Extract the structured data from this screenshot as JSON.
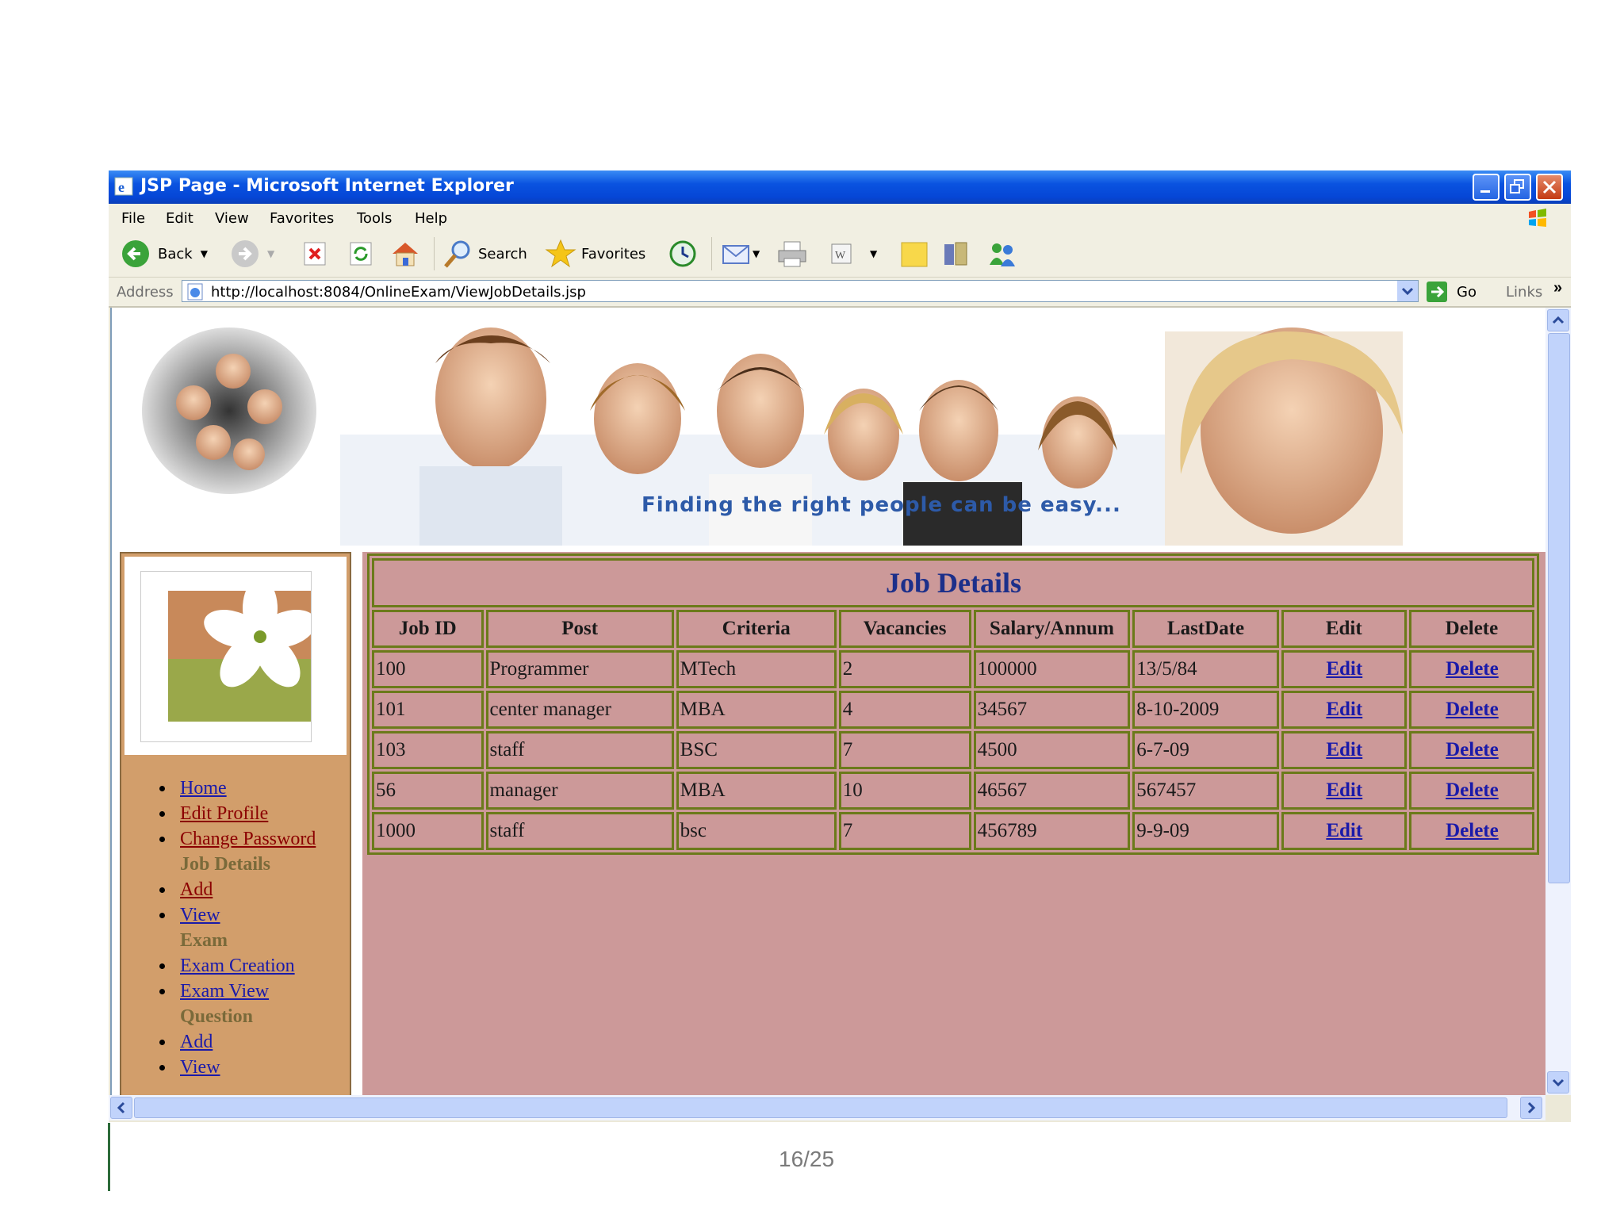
{
  "window": {
    "title": "JSP Page - Microsoft Internet Explorer"
  },
  "menu": [
    "File",
    "Edit",
    "View",
    "Favorites",
    "Tools",
    "Help"
  ],
  "toolbar": {
    "back_label": "Back",
    "search_label": "Search",
    "favorites_label": "Favorites"
  },
  "address": {
    "label": "Address",
    "url": "http://localhost:8084/OnlineExam/ViewJobDetails.jsp",
    "go_label": "Go",
    "links_label": "Links"
  },
  "banner": {
    "caption": "Finding the right people can be easy..."
  },
  "nav": {
    "home": "Home",
    "edit_profile": "Edit Profile",
    "change_password": "Change Password",
    "job_heading": "Job Details",
    "job_add": "Add",
    "job_view": "View",
    "exam_heading": "Exam",
    "exam_creation": "Exam Creation",
    "exam_view": "Exam View",
    "question_heading": "Question",
    "question_add": "Add",
    "question_view": "View"
  },
  "jobs": {
    "title": "Job Details",
    "headers": [
      "Job ID",
      "Post",
      "Criteria",
      "Vacancies",
      "Salary/Annum",
      "LastDate",
      "Edit",
      "Delete"
    ],
    "rows": [
      [
        "100",
        "Programmer",
        "MTech",
        "2",
        "100000",
        "13/5/84",
        "Edit",
        "Delete"
      ],
      [
        "101",
        "center manager",
        "MBA",
        "4",
        "34567",
        "8-10-2009",
        "Edit",
        "Delete"
      ],
      [
        "103",
        "staff",
        "BSC",
        "7",
        "4500",
        "6-7-09",
        "Edit",
        "Delete"
      ],
      [
        "56",
        "manager",
        "MBA",
        "10",
        "46567",
        "567457",
        "Edit",
        "Delete"
      ],
      [
        "1000",
        "staff",
        "bsc",
        "7",
        "456789",
        "9-9-09",
        "Edit",
        "Delete"
      ]
    ]
  },
  "slide": {
    "page_number": "16/25"
  }
}
